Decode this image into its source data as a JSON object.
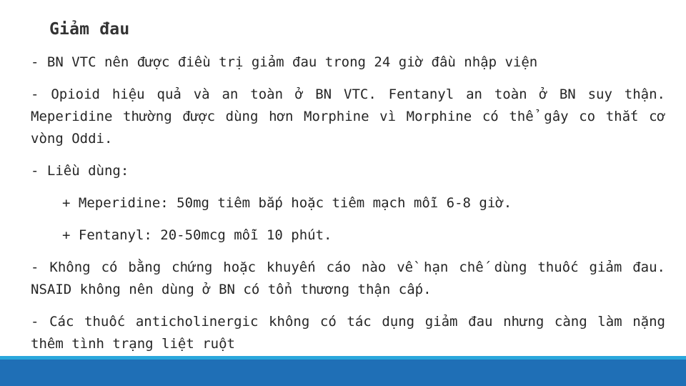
{
  "slide": {
    "title": "Giảm đau",
    "paragraphs": [
      " - BN VTC nên được điều trị giảm đau trong 24 giờ đầu nhập viện",
      " - Opioid hiệu quả và an toàn ở BN VTC. Fentanyl an toàn ở BN suy thận. Meperidine thường được dùng hơn Morphine vì Morphine có thể gây co thắt cơ vòng Oddi.",
      " - Liều dùng:"
    ],
    "sub_items": [
      "+ Meperidine: 50mg tiêm bắp hoặc tiêm mạch mỗi 6-8 giờ.",
      "+ Fentanyl: 20-50mcg mỗi 10 phút."
    ],
    "paragraphs_after": [
      " - Không có bằng chứng hoặc khuyến cáo nào về hạn chế dùng thuốc giảm đau. NSAID không nên dùng ở BN có tổn thương thận cấp.",
      " - Các thuốc anticholinergic không có tác dụng giảm đau nhưng càng làm nặng thêm tình trạng liệt ruột"
    ]
  },
  "colors": {
    "footer_bar_light": "#2aa7dc",
    "footer_bar_dark": "#1f6fb6",
    "text": "#262626"
  }
}
